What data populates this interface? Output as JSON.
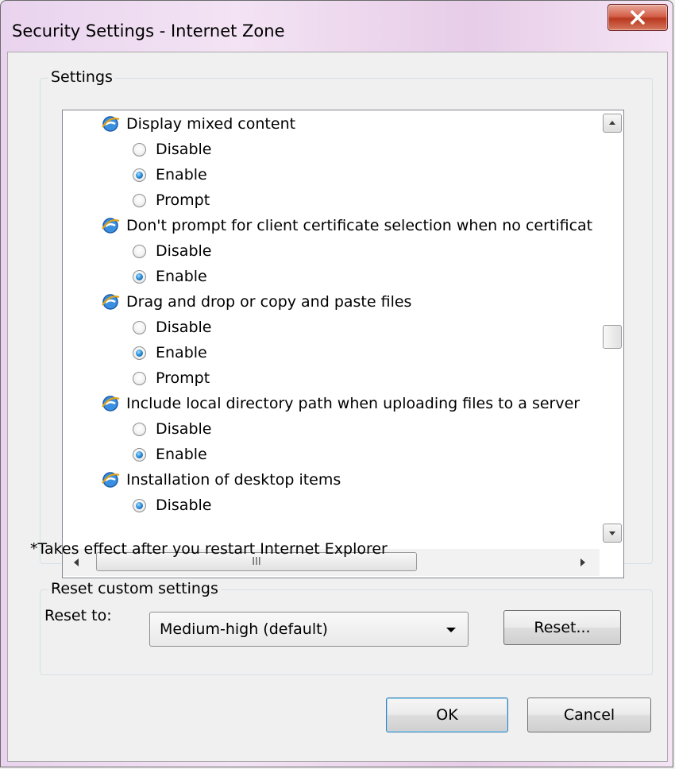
{
  "window": {
    "title": "Security Settings - Internet Zone",
    "close_label": "X"
  },
  "settings": {
    "group_label": "Settings",
    "rows": [
      {
        "type": "header",
        "label": "Display mixed content",
        "icon": "ie-icon"
      },
      {
        "type": "option",
        "label": "Disable",
        "checked": false
      },
      {
        "type": "option",
        "label": "Enable",
        "checked": true
      },
      {
        "type": "option",
        "label": "Prompt",
        "checked": false
      },
      {
        "type": "header",
        "label": "Don't prompt for client certificate selection when no certificat",
        "icon": "ie-icon"
      },
      {
        "type": "option",
        "label": "Disable",
        "checked": false
      },
      {
        "type": "option",
        "label": "Enable",
        "checked": true
      },
      {
        "type": "header",
        "label": "Drag and drop or copy and paste files",
        "icon": "ie-icon"
      },
      {
        "type": "option",
        "label": "Disable",
        "checked": false
      },
      {
        "type": "option",
        "label": "Enable",
        "checked": true
      },
      {
        "type": "option",
        "label": "Prompt",
        "checked": false
      },
      {
        "type": "header",
        "label": "Include local directory path when uploading files to a server",
        "icon": "ie-icon"
      },
      {
        "type": "option",
        "label": "Disable",
        "checked": false
      },
      {
        "type": "option",
        "label": "Enable",
        "checked": true
      },
      {
        "type": "header",
        "label": "Installation of desktop items",
        "icon": "ie-icon"
      },
      {
        "type": "option",
        "label": "Disable",
        "checked": true
      }
    ],
    "hscroll_grip": "III",
    "note": "*Takes effect after you restart Internet Explorer"
  },
  "reset": {
    "group_label": "Reset custom settings",
    "reset_to_label": "Reset to:",
    "selected_level": "Medium-high (default)",
    "reset_button": "Reset..."
  },
  "footer": {
    "ok_label": "OK",
    "cancel_label": "Cancel"
  },
  "colors": {
    "radio_checked": "#2a8ad4",
    "close_button": "#c9462c",
    "title_bar": "#ead4ee"
  }
}
